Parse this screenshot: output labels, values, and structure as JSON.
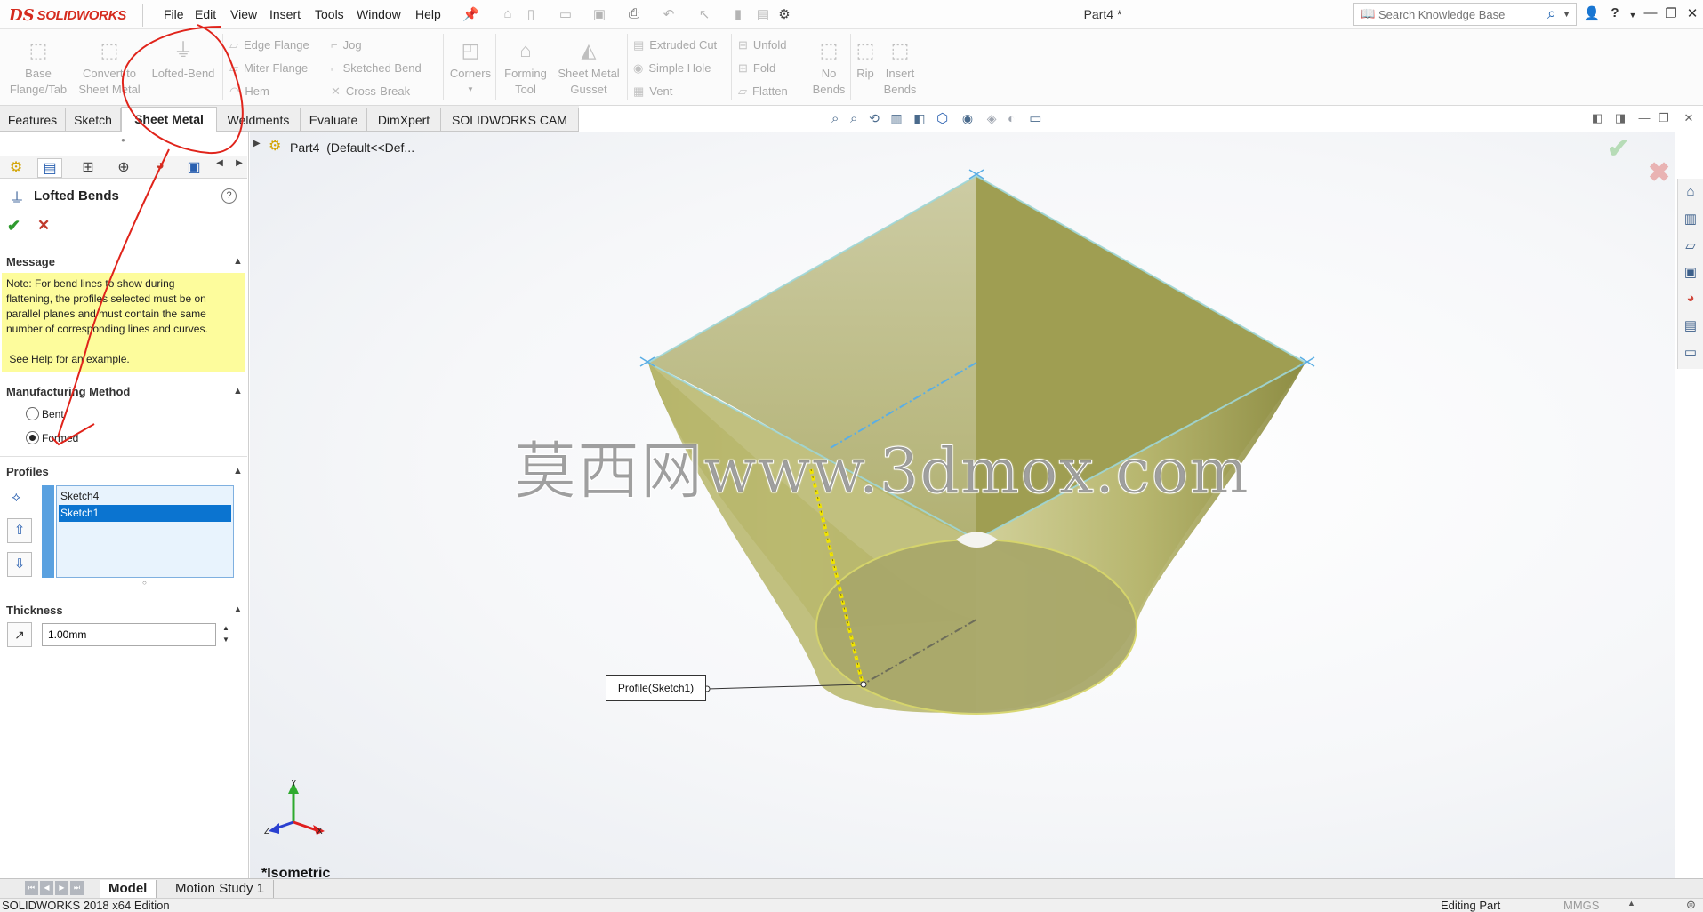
{
  "app": {
    "logo_prefix": "DS",
    "logo_name": "SOLIDWORKS",
    "doc_title": "Part4 *"
  },
  "menu": [
    "File",
    "Edit",
    "View",
    "Insert",
    "Tools",
    "Window",
    "Help"
  ],
  "search": {
    "placeholder": "Search Knowledge Base"
  },
  "command_manager": {
    "big_buttons": [
      {
        "label": "Base\nFlange/Tab",
        "icon": "base-flange-icon"
      },
      {
        "label": "Convert to\nSheet Metal",
        "icon": "convert-sheet-metal-icon"
      },
      {
        "label": "Lofted-Bend",
        "icon": "lofted-bend-icon"
      },
      {
        "label": "Corners",
        "icon": "corners-icon"
      },
      {
        "label": "Forming\nTool",
        "icon": "forming-tool-icon"
      },
      {
        "label": "Sheet Metal\nGusset",
        "icon": "gusset-icon"
      },
      {
        "label": "No\nBends",
        "icon": "no-bends-icon"
      },
      {
        "label": "Rip",
        "icon": "rip-icon"
      },
      {
        "label": "Insert\nBends",
        "icon": "insert-bends-icon"
      }
    ],
    "small_buttons": [
      {
        "label": "Edge Flange"
      },
      {
        "label": "Miter Flange"
      },
      {
        "label": "Hem"
      },
      {
        "label": "Jog"
      },
      {
        "label": "Sketched Bend"
      },
      {
        "label": "Cross-Break"
      },
      {
        "label": "Extruded Cut"
      },
      {
        "label": "Simple Hole"
      },
      {
        "label": "Vent"
      },
      {
        "label": "Unfold"
      },
      {
        "label": "Fold"
      },
      {
        "label": "Flatten"
      }
    ]
  },
  "tabs": [
    "Features",
    "Sketch",
    "Sheet Metal",
    "Weldments",
    "Evaluate",
    "DimXpert",
    "SOLIDWORKS CAM"
  ],
  "active_tab": "Sheet Metal",
  "property_manager": {
    "title": "Lofted Bends",
    "help": "?",
    "message_header": "Message",
    "message_lines": [
      "Note: For bend lines to show during",
      "flattening, the profiles selected must be on",
      "parallel planes and must contain the same",
      "number of corresponding lines and curves."
    ],
    "message_help": " See Help for an example.",
    "method_header": "Manufacturing Method",
    "method_options": [
      "Bent",
      "Formed"
    ],
    "method_selected": "Formed",
    "profiles_header": "Profiles",
    "profiles": [
      "Sketch4",
      "Sketch1"
    ],
    "profile_selected": "Sketch1",
    "thickness_header": "Thickness",
    "thickness_value": "1.00mm"
  },
  "tree": {
    "part": "Part4",
    "config": "(Default<<Def..."
  },
  "viewport": {
    "callout": "Profile(Sketch1)",
    "orientation": "*Isometric",
    "watermark": "莫西网www.3dmox.com",
    "triad": {
      "x": "X",
      "y": "Y",
      "z": "Z"
    }
  },
  "bottom_tabs": [
    "Model",
    "Motion Study 1"
  ],
  "active_bottom_tab": "Model",
  "status": {
    "left": "SOLIDWORKS 2018 x64 Edition",
    "editing": "Editing Part",
    "units": "MMGS"
  },
  "colors": {
    "accent_blue": "#0b74d0",
    "message_yellow": "#fdfc9c",
    "part_color": "#b3b25a",
    "annotation_red": "#e0241b",
    "brand_red": "#d52b1e"
  }
}
